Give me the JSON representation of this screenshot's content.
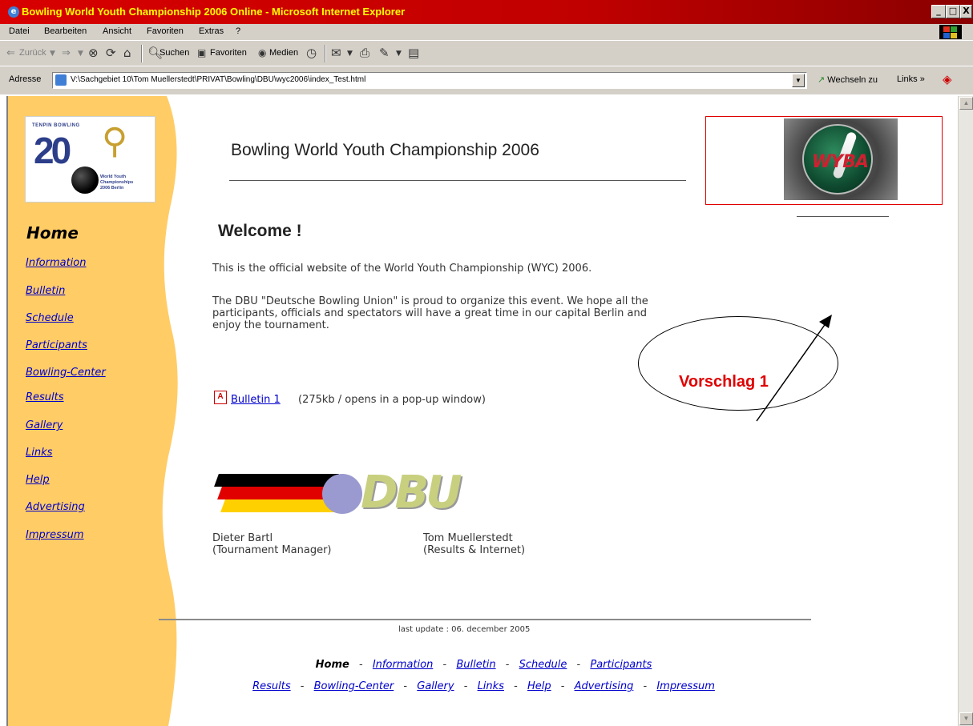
{
  "window": {
    "title": "Bowling World Youth Championship 2006 Online - Microsoft Internet Explorer",
    "minimize": "_",
    "maximize": "□",
    "close": "X"
  },
  "menu": [
    "Datei",
    "Bearbeiten",
    "Ansicht",
    "Favoriten",
    "Extras",
    "?"
  ],
  "toolbar": {
    "back": "Zurück",
    "search": "Suchen",
    "favorites": "Favoriten",
    "media": "Medien"
  },
  "address": {
    "label": "Adresse",
    "url": "V:\\Sachgebiet 10\\Tom Muellerstedt\\PRIVAT\\Bowling\\DBU\\wyc2006\\index_Test.html",
    "go": "Wechseln zu",
    "links": "Links"
  },
  "page": {
    "title": "Bowling World Youth Championship 2006",
    "welcome": "Welcome !",
    "intro": "This is the official website of the World Youth Championship (WYC) 2006.",
    "paragraph_lines": [
      "The DBU \"Deutsche Bowling Union\" is proud to organize this event. We hope all the",
      "participants, officials and spectators will have a great time in our capital Berlin and",
      "enjoy the tournament."
    ],
    "bulletin_link": "Bulletin 1",
    "bulletin_note": "(275kb / opens in a pop-up window)",
    "last_update": "last update : 06. december 2005"
  },
  "logo": {
    "small_title": "TENPIN BOWLING",
    "year": "20",
    "sub_lines": [
      "World Youth",
      "Championships",
      "2006 Berlin"
    ]
  },
  "wyba_logo_text": "WYBA",
  "dbu_logo_text": "DBU",
  "sidebar": {
    "current": "Home",
    "links": [
      "Information",
      "Bulletin",
      "Schedule",
      "Participants",
      "Bowling-Center",
      "Results",
      "Gallery",
      "Links",
      "Help",
      "Advertising",
      "Impressum"
    ]
  },
  "people": [
    {
      "name": "Dieter Bartl",
      "role": "(Tournament Manager)"
    },
    {
      "name": "Tom Muellerstedt",
      "role": "(Results & Internet)"
    }
  ],
  "footer": {
    "row1_current": "Home",
    "row1_links": [
      "Information",
      "Bulletin",
      "Schedule",
      "Participants"
    ],
    "row2_links": [
      "Results",
      "Bowling-Center",
      "Gallery",
      "Links",
      "Help",
      "Advertising",
      "Impressum"
    ],
    "separator": "-"
  },
  "annotation": {
    "label": "Vorschlag 1",
    "color": "#e00000"
  },
  "colors": {
    "sidebar": "#ffcc66",
    "link": "#0000cc",
    "titlebar": "#cc0000"
  }
}
